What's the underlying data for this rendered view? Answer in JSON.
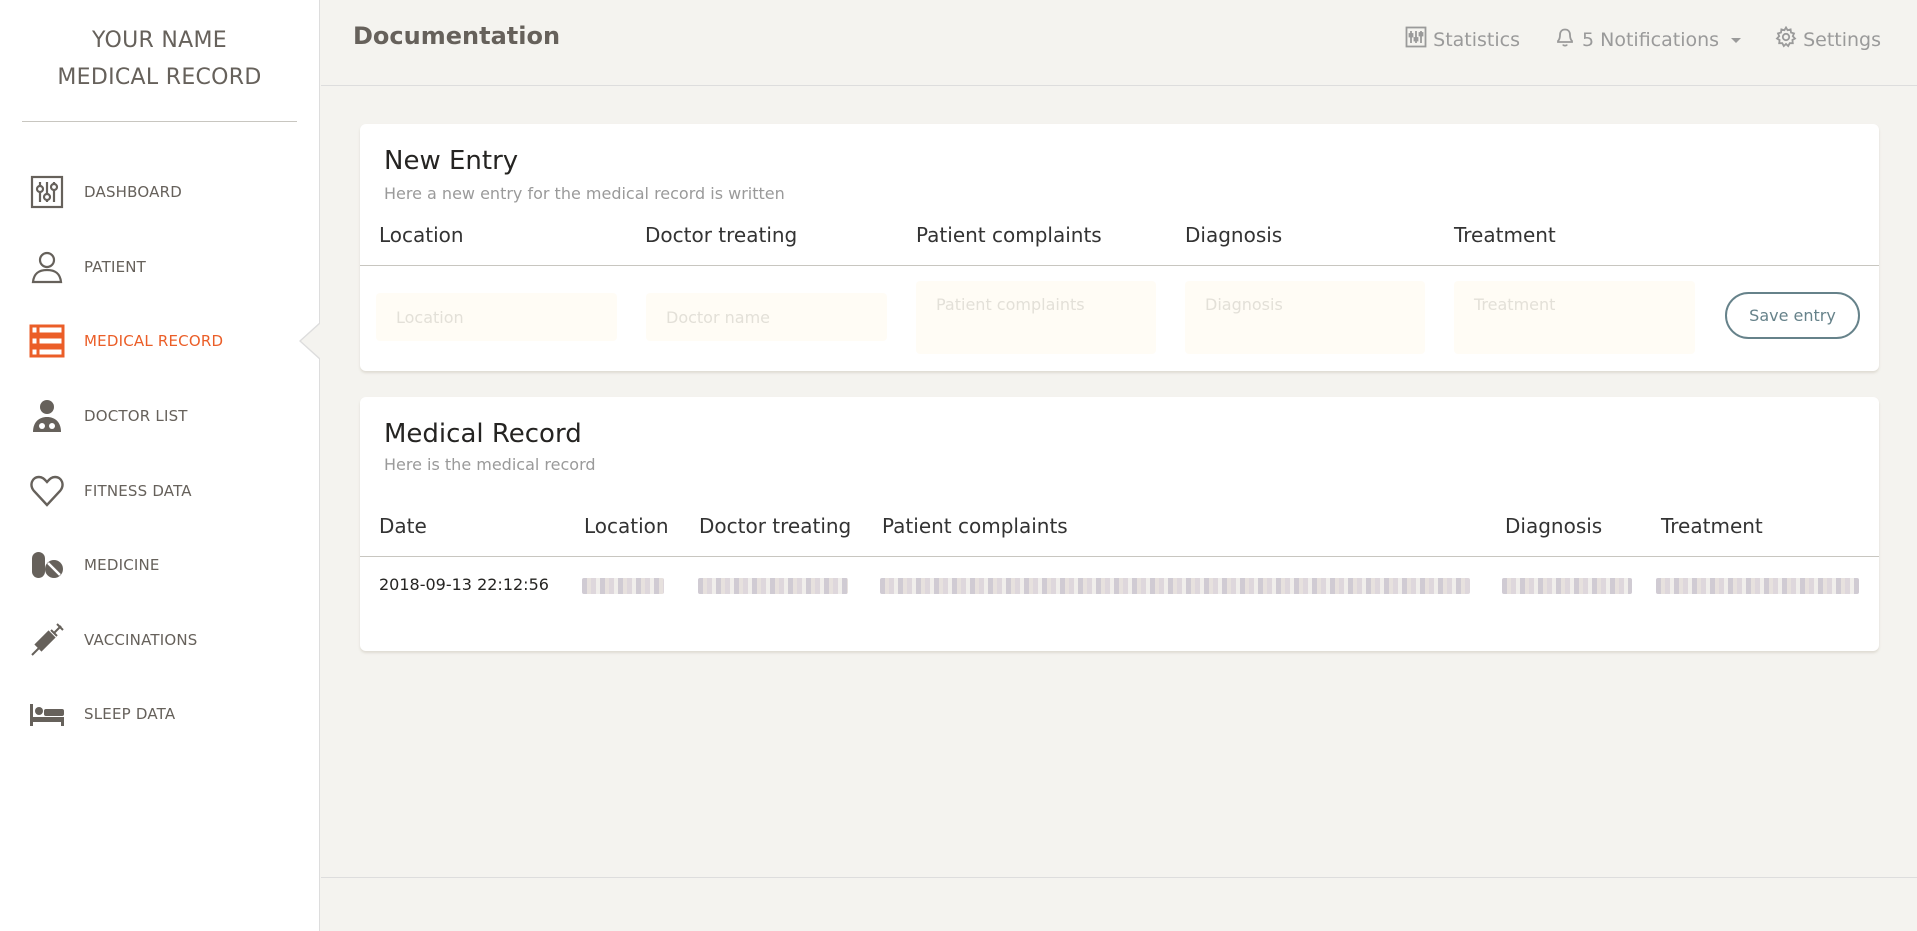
{
  "sidebar": {
    "logo_line1": "YOUR NAME",
    "logo_line2": "MEDICAL RECORD",
    "items": [
      {
        "label": "DASHBOARD",
        "icon": "sliders-icon",
        "active": false
      },
      {
        "label": "PATIENT",
        "icon": "user-icon",
        "active": false
      },
      {
        "label": "MEDICAL RECORD",
        "icon": "list-icon",
        "active": true
      },
      {
        "label": "DOCTOR LIST",
        "icon": "doctor-icon",
        "active": false
      },
      {
        "label": "FITNESS DATA",
        "icon": "heart-icon",
        "active": false
      },
      {
        "label": "MEDICINE",
        "icon": "pill-icon",
        "active": false
      },
      {
        "label": "VACCINATIONS",
        "icon": "syringe-icon",
        "active": false
      },
      {
        "label": "SLEEP DATA",
        "icon": "bed-icon",
        "active": false
      }
    ]
  },
  "header": {
    "title": "Documentation",
    "statistics": "Statistics",
    "notifications": "5 Notifications",
    "settings": "Settings"
  },
  "new_entry": {
    "title": "New Entry",
    "subtitle": "Here a new entry for the medical record is written",
    "columns": [
      "Location",
      "Doctor treating",
      "Patient complaints",
      "Diagnosis",
      "Treatment"
    ],
    "placeholders": {
      "location": "Location",
      "doctor": "Doctor name",
      "complaints": "Patient complaints",
      "diagnosis": "Diagnosis",
      "treatment": "Treatment"
    },
    "save_label": "Save entry"
  },
  "record": {
    "title": "Medical Record",
    "subtitle": "Here is the medical record",
    "columns": [
      "Date",
      "Location",
      "Doctor treating",
      "Patient complaints",
      "Diagnosis",
      "Treatment"
    ],
    "rows": [
      {
        "date": "2018-09-13 22:12:56"
      }
    ]
  },
  "colors": {
    "accent": "#eb5e28",
    "icon_gray": "#66615b",
    "button_border": "#66828a",
    "background": "#f4f3ef"
  }
}
